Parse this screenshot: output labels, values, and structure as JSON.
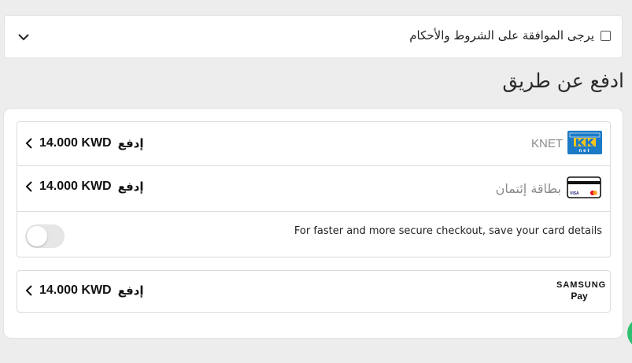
{
  "terms": {
    "label": "يرجى الموافقة على الشروط والأحكام",
    "checked": false
  },
  "pay_section": {
    "title": "ادفع عن طريق"
  },
  "methods": [
    {
      "name": "KNET",
      "pay_word": "إدفع",
      "amount": "14.000 KWD",
      "icon": "knet-logo"
    },
    {
      "name": "بطاقة إئتمان",
      "pay_word": "إدفع",
      "amount": "14.000 KWD",
      "icon": "credit-card-icon"
    },
    {
      "name": "",
      "pay_word": "إدفع",
      "amount": "14.000 KWD",
      "icon": "samsung-pay-logo"
    }
  ],
  "save_card": {
    "label": "For faster and more secure checkout, save your card details",
    "enabled": false
  },
  "logos": {
    "knet_text": "net",
    "samsung_word": "SAMSUNG",
    "samsung_pay": "Pay",
    "visa": "VISA"
  },
  "colors": {
    "background": "#ededed",
    "card": "#ffffff",
    "knet_blue": "#1c7bc6",
    "knet_yellow": "#f7c51e",
    "accent_green": "#2fbf71"
  }
}
